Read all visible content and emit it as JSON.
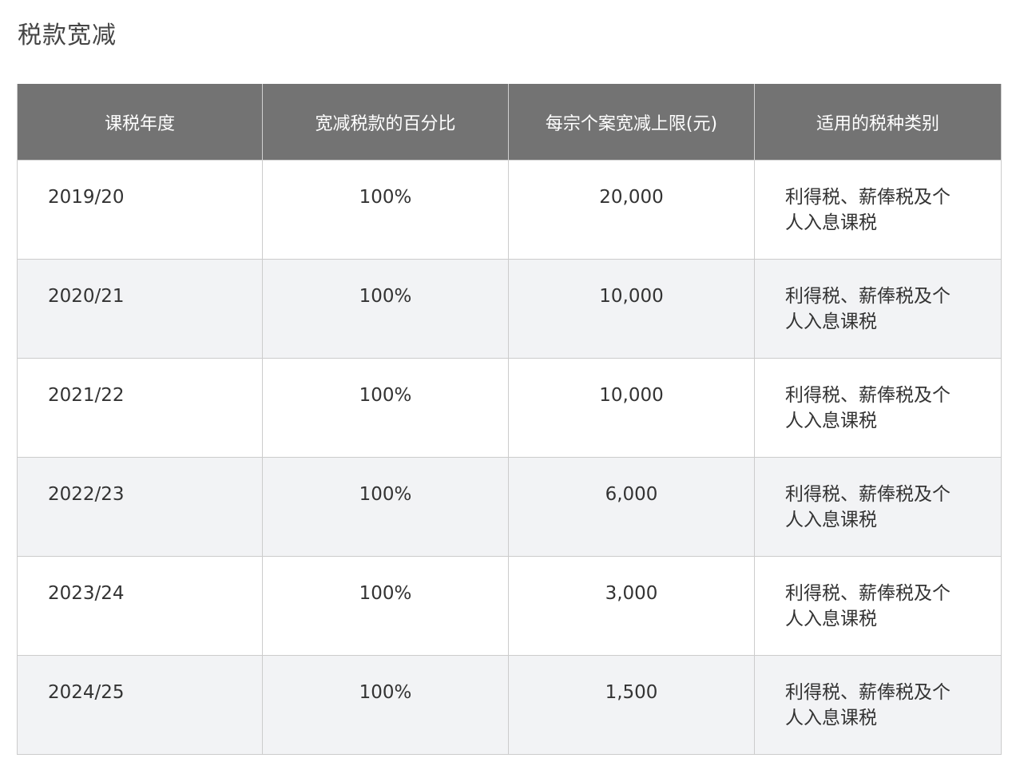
{
  "page": {
    "title": "税款宽减"
  },
  "table": {
    "headers": [
      "课税年度",
      "宽减税款的百分比",
      "每宗个案宽减上限(元)",
      "适用的税种类别"
    ],
    "rows": [
      {
        "year": "2019/20",
        "percentage": "100%",
        "cap": "20,000",
        "tax_types": "利得税、薪俸税及个人入息课税"
      },
      {
        "year": "2020/21",
        "percentage": "100%",
        "cap": "10,000",
        "tax_types": "利得税、薪俸税及个人入息课税"
      },
      {
        "year": "2021/22",
        "percentage": "100%",
        "cap": "10,000",
        "tax_types": "利得税、薪俸税及个人入息课税"
      },
      {
        "year": "2022/23",
        "percentage": "100%",
        "cap": "6,000",
        "tax_types": "利得税、薪俸税及个人入息课税"
      },
      {
        "year": "2023/24",
        "percentage": "100%",
        "cap": "3,000",
        "tax_types": "利得税、薪俸税及个人入息课税"
      },
      {
        "year": "2024/25",
        "percentage": "100%",
        "cap": "1,500",
        "tax_types": "利得税、薪俸税及个人入息课税"
      }
    ]
  }
}
